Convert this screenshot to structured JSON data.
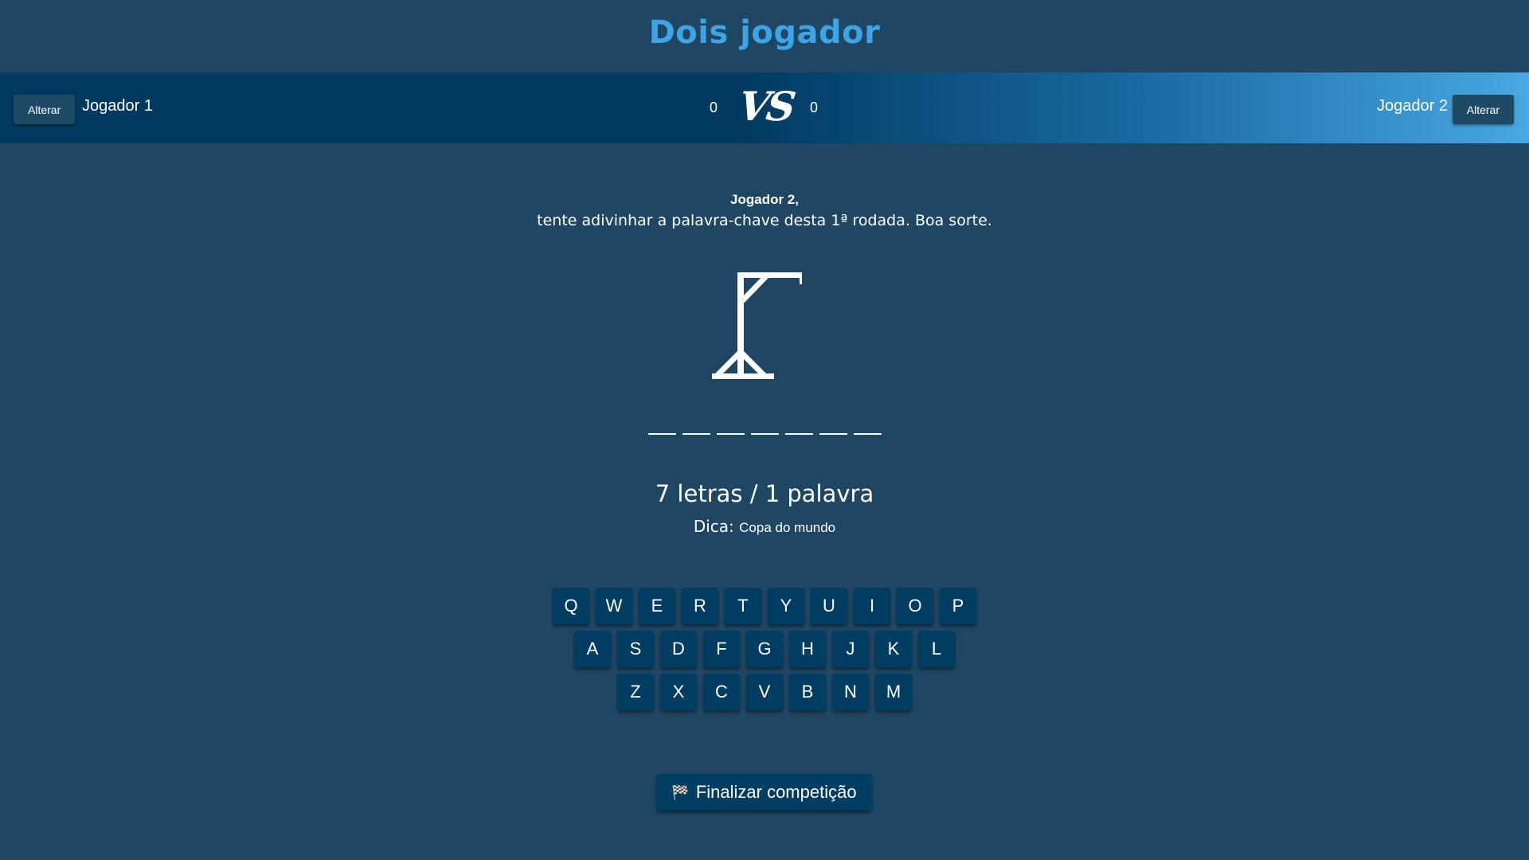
{
  "header": {
    "title": "Dois jogador"
  },
  "scoreboard": {
    "player1": {
      "name": "Jogador 1",
      "score": "0",
      "alter_label": "Alterar"
    },
    "player2": {
      "name": "Jogador 2",
      "score": "0",
      "alter_label": "Alterar"
    },
    "vs_label": "VS"
  },
  "round": {
    "player": "Jogador 2,",
    "instruction": "tente adivinhar a palavra-chave desta 1ª rodada. Boa sorte."
  },
  "word": {
    "length": 7,
    "info": "7 letras / 1 palavra",
    "hint_label": "Dica:",
    "hint_value": "Copa do mundo"
  },
  "keyboard": {
    "rows": [
      [
        "Q",
        "W",
        "E",
        "R",
        "T",
        "Y",
        "U",
        "I",
        "O",
        "P"
      ],
      [
        "A",
        "S",
        "D",
        "F",
        "G",
        "H",
        "J",
        "K",
        "L"
      ],
      [
        "Z",
        "X",
        "C",
        "V",
        "B",
        "N",
        "M"
      ]
    ]
  },
  "actions": {
    "finish_label": "Finalizar competição",
    "finish_icon": "checkered-flag-icon"
  },
  "colors": {
    "background": "#1f4662",
    "title": "#3da4e6",
    "key": "#003d63"
  }
}
